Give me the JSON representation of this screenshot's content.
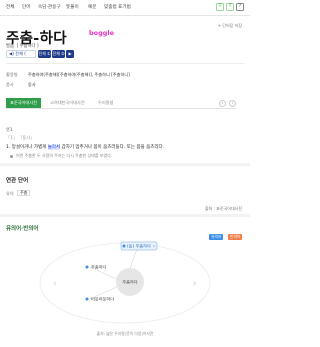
{
  "nav": {
    "tabs": [
      "전체",
      "단어",
      "속담·관용구",
      "뜻풀이",
      "예문",
      "맞춤법 표기법"
    ],
    "right_buttons": [
      "T",
      "T",
      "?"
    ]
  },
  "word_link": "+ 단어장 저장",
  "entry": {
    "headword": "주춤-하다",
    "brand": "boggle",
    "pron_label": "발음",
    "pron_value": "[ 주춤하다 ]",
    "audio_main": "◀) 전체 (",
    "audio_buttons": [
      "전체 ①",
      "전체 ②",
      "▶"
    ]
  },
  "info": {
    "conj_label": "활용형",
    "conj_value": "주춤하여(주춤해)[주춤하여(주춤해)], 주춤하니 [주춤하니]",
    "pos_label": "품사",
    "pos_value": "동사"
  },
  "tabs": {
    "items": [
      "표준국어대사전",
      "고려대한국어대사전",
      "우리말샘"
    ]
  },
  "meaning": {
    "section": "뜻1",
    "sub": "「1」 「동사」",
    "def_prefix": "1.  망설이거나 가볍게 ",
    "def_highlight": "놀라서",
    "def_suffix": " 갑자기 멈추거나 몸이 움츠러들다. 또는 몸을 움츠리다.",
    "example": "어떤 주춤한 두 사람의 주저는 다시 주춤한 상태를 보였다."
  },
  "related": {
    "title": "연관 단어",
    "label": "유의",
    "chip": "주춤",
    "more": "출처 : 표준국어대사전"
  },
  "network": {
    "title": "유의어·반의어",
    "legend": [
      "유의어",
      "반의어"
    ],
    "center": "주춤하다",
    "nodes": [
      "(동) 주춤하다 ☆",
      "주춤하다",
      "머뭇머뭇하다"
    ]
  },
  "footer": {
    "source": "출처: 넓은 우리말(뜻이 다양)어사전"
  },
  "colors": {
    "accent_green": "#2e9e4a",
    "navy": "#1e3a8a",
    "boggle_pink": "#e535c4",
    "legend_blue": "#3a8ee8",
    "legend_orange": "#f07d4a"
  }
}
